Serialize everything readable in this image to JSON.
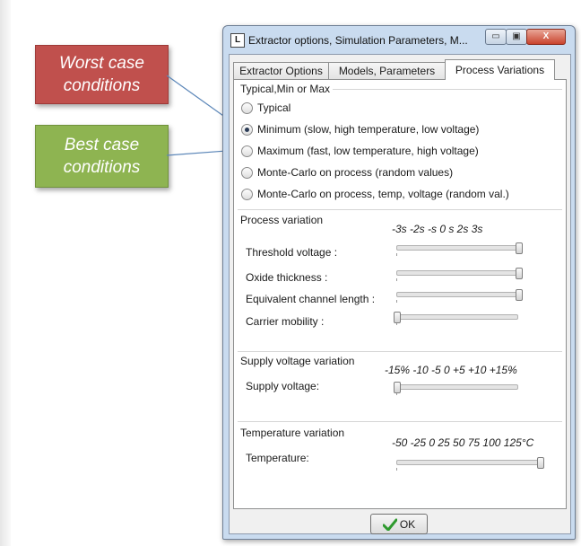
{
  "callouts": {
    "worst": "Worst case\nconditions",
    "best": "Best case\nconditions"
  },
  "window": {
    "app_icon_glyph": "L",
    "title": "Extractor options, Simulation Parameters, M...",
    "minimize_glyph": "▭",
    "maximize_glyph": "▣",
    "close_glyph": "X"
  },
  "tabs": [
    "Extractor Options",
    "Models, Parameters",
    "Process Variations"
  ],
  "active_tab": "Process Variations",
  "typical_group": {
    "title": "Typical,Min or Max",
    "options": [
      {
        "label": "Typical",
        "selected": false
      },
      {
        "label": "Minimum (slow, high temperature, low voltage)",
        "selected": true
      },
      {
        "label": "Maximum (fast, low temperature, high voltage)",
        "selected": false
      },
      {
        "label": "Monte-Carlo on process (random values)",
        "selected": false
      },
      {
        "label": "Monte-Carlo on process, temp, voltage (random val.)",
        "selected": false
      }
    ]
  },
  "process_variation": {
    "title": "Process variation",
    "scale": "-3s  -2s  -s   0   s   2s  3s",
    "sliders": [
      {
        "label": "Threshold voltage :",
        "value": 1.0
      },
      {
        "label": "Oxide thickness :",
        "value": 1.0
      },
      {
        "label": "Equivalent channel length :",
        "value": 1.0
      },
      {
        "label": "Carrier mobility :",
        "value": 0.0
      }
    ]
  },
  "supply_variation": {
    "title": "Supply voltage variation",
    "scale": "-15% -10  -5   0  +5  +10 +15%",
    "sliders": [
      {
        "label": "Supply voltage:",
        "value": 0.0
      }
    ]
  },
  "temperature_variation": {
    "title": "Temperature variation",
    "scale": "-50  -25  0   25   50   75  100  125°C",
    "sliders": [
      {
        "label": "Temperature:",
        "value": 1.0
      }
    ]
  },
  "ok_button": {
    "label": "OK",
    "icon": "check-icon"
  },
  "colors": {
    "worst": "#c0504d",
    "best": "#8eb451",
    "check": "#2e9a2e"
  }
}
